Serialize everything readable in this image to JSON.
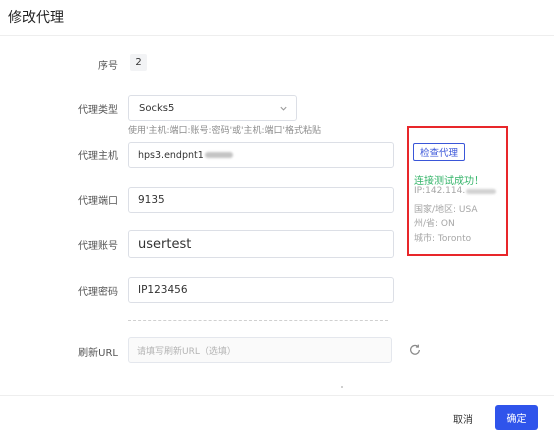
{
  "dialog": {
    "title": "修改代理"
  },
  "fields": {
    "serial": {
      "label": "序号",
      "value": "2"
    },
    "proxy_type": {
      "label": "代理类型",
      "value": "Socks5",
      "hint": "使用'主机:端口:账号:密码'或'主机:端口'格式粘贴"
    },
    "host": {
      "label": "代理主机",
      "value": "hps3.endpnt1"
    },
    "port": {
      "label": "代理端口",
      "value": "9135"
    },
    "account": {
      "label": "代理账号",
      "value": "usertest"
    },
    "password": {
      "label": "代理密码",
      "value": "IP123456"
    },
    "refresh_url": {
      "label": "刷新URL",
      "placeholder": "请填写刷新URL（选填）"
    }
  },
  "check": {
    "button_label": "检查代理",
    "success_text": "连接测试成功！",
    "ip_prefix": "IP:142.114.",
    "country": "国家/地区: USA",
    "province": "州/省: ON",
    "city": "城市: Toronto",
    "highlight_color": "#e8262a",
    "success_color": "#35b56a"
  },
  "footer": {
    "cancel_label": "取消",
    "confirm_label": "确定",
    "accent_color": "#2f54eb"
  },
  "icons": {
    "dropdown": "chevron-down-icon",
    "refresh": "refresh-icon"
  }
}
